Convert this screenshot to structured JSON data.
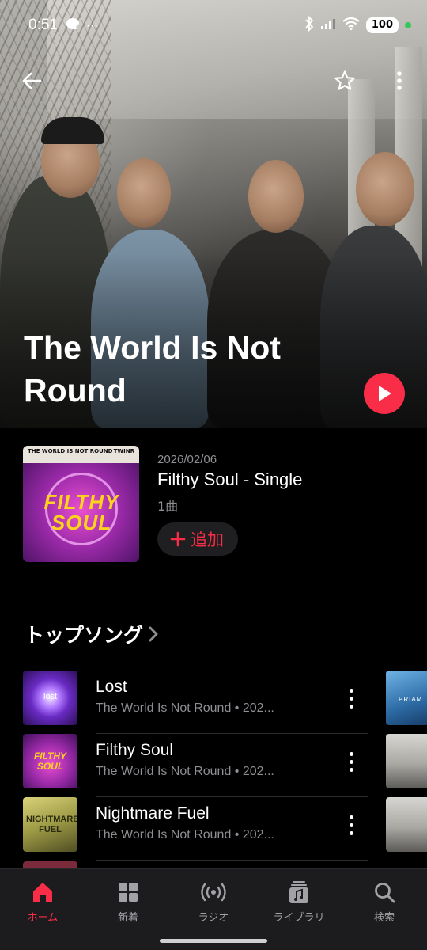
{
  "status_bar": {
    "time": "0:51",
    "dots": "···",
    "battery": "100"
  },
  "hero": {
    "title": "The World Is Not Round"
  },
  "release": {
    "date": "2026/02/06",
    "title": "Filthy Soul - Single",
    "track_count": "1曲",
    "add_label": "追加",
    "cover_header": "THE WORLD IS NOT ROUND",
    "cover_tag": "TWINR",
    "cover_word_1": "FILTHY",
    "cover_word_2": "SOUL"
  },
  "top_songs": {
    "title": "トップソング",
    "items": [
      {
        "title": "Lost",
        "subtitle": "The World Is Not Round • 202...",
        "art_text": "lost"
      },
      {
        "title": "Filthy Soul",
        "subtitle": "The World Is Not Round • 202...",
        "art_text": "FILTHY SOUL"
      },
      {
        "title": "Nightmare Fuel",
        "subtitle": "The World Is Not Round • 202...",
        "art_text": "NIGHTMARE FUEL"
      }
    ],
    "peek_text": "PRIAM"
  },
  "tab_bar": {
    "tabs": [
      {
        "label": "ホーム",
        "icon": "home-icon",
        "active": true
      },
      {
        "label": "新着",
        "icon": "grid-icon",
        "active": false
      },
      {
        "label": "ラジオ",
        "icon": "radio-icon",
        "active": false
      },
      {
        "label": "ライブラリ",
        "icon": "library-icon",
        "active": false
      },
      {
        "label": "検索",
        "icon": "search-icon",
        "active": false
      }
    ]
  },
  "colors": {
    "accent": "#fa2d48",
    "background": "#000000",
    "secondary_text": "#8e8e93"
  }
}
